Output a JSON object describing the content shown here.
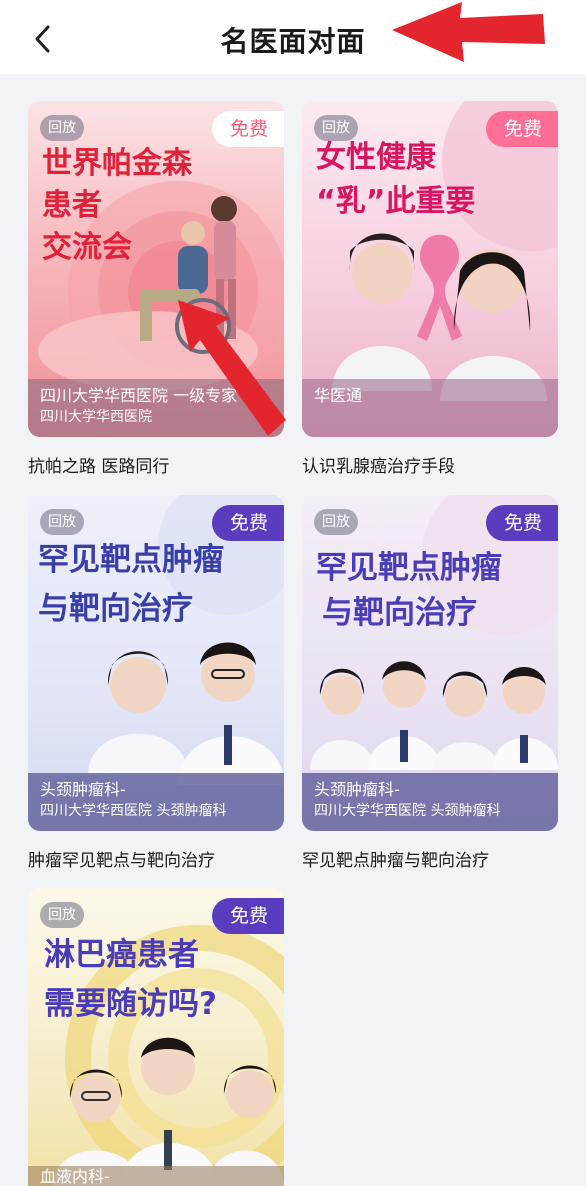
{
  "header": {
    "title": "名医面对面"
  },
  "cards": [
    {
      "replay": "回放",
      "free": "免费",
      "headline": [
        "世界帕金森",
        "患者",
        "交流会"
      ],
      "band": [
        "四川大学华西医院 一级专家",
        "四川大学华西医院"
      ],
      "caption": "抗帕之路 医路同行"
    },
    {
      "replay": "回放",
      "free": "免费",
      "headline": [
        "女性健康",
        "“乳”此重要"
      ],
      "band": [
        "华医通"
      ],
      "caption": "认识乳腺癌治疗手段"
    },
    {
      "replay": "回放",
      "free": "免费",
      "headline": [
        "罕见靶点肿瘤",
        "与靶向治疗"
      ],
      "band": [
        "头颈肿瘤科-",
        "四川大学华西医院 头颈肿瘤科"
      ],
      "caption": "肿瘤罕见靶点与靶向治疗"
    },
    {
      "replay": "回放",
      "free": "免费",
      "headline": [
        "罕见靶点肿瘤",
        "与靶向治疗"
      ],
      "band": [
        "头颈肿瘤科-",
        "四川大学华西医院 头颈肿瘤科"
      ],
      "caption": "罕见靶点肿瘤与靶向治疗"
    },
    {
      "replay": "回放",
      "free": "免费",
      "headline": [
        "淋巴癌患者",
        "需要随访吗?"
      ],
      "band": [
        "血液内科-"
      ],
      "caption": ""
    }
  ],
  "colors": {
    "annotation_red": "#e3262e",
    "free_purple": "#5a3dbf",
    "free_pink": "#ff6f95"
  },
  "icons": {
    "back": "chevron-left-icon"
  }
}
